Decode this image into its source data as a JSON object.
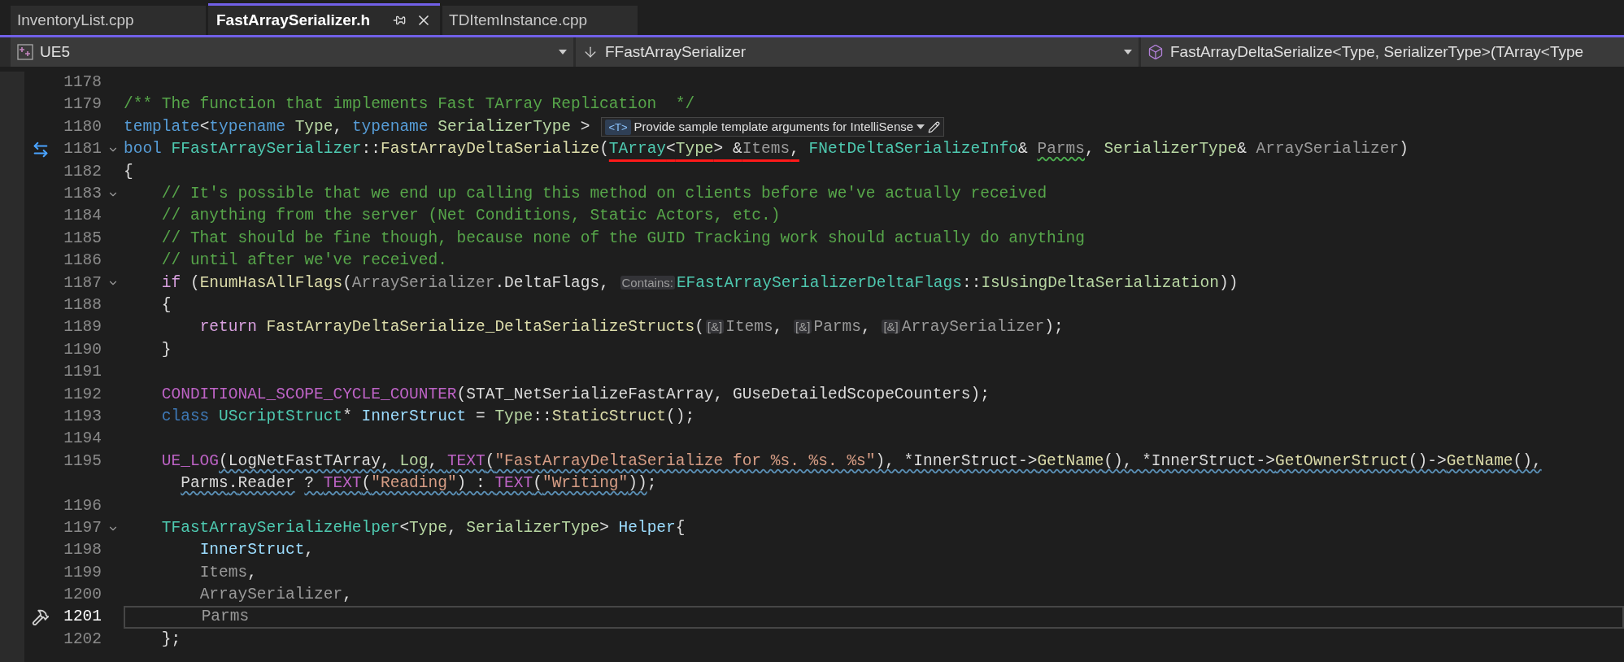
{
  "tabs": [
    {
      "label": "InventoryList.cpp",
      "selected": false
    },
    {
      "label": "FastArraySerializer.h",
      "selected": true
    },
    {
      "label": "TDItemInstance.cpp",
      "selected": false
    }
  ],
  "nav_bar": [
    {
      "kind": "project",
      "text": "UE5",
      "dropdown_arrow": true
    },
    {
      "kind": "scope",
      "text": "FFastArraySerializer",
      "dropdown_arrow": true
    },
    {
      "kind": "member",
      "text": "FastArrayDeltaSerialize<Type, SerializerType>(TArray<Type",
      "dropdown_arrow": false
    }
  ],
  "lines": [
    {
      "number": "1178",
      "fold": false,
      "current": false
    },
    {
      "number": "1179",
      "fold": false,
      "current": false,
      "tokens": [
        {
          "kind": "cm",
          "text": "/** The function that implements Fast TArray Replication  */"
        }
      ]
    },
    {
      "number": "1180",
      "fold": false,
      "current": false,
      "tokens": [
        {
          "kind": "kw",
          "text": "template"
        },
        {
          "kind": "p",
          "text": "<"
        },
        {
          "kind": "kw",
          "text": "typename "
        },
        {
          "kind": "tp",
          "text": "Type"
        },
        {
          "kind": "p",
          "text": ", "
        },
        {
          "kind": "kw",
          "text": "typename "
        },
        {
          "kind": "tp",
          "text": "SerializerType"
        },
        {
          "kind": "p",
          "text": " >"
        }
      ],
      "hint_bar": {
        "badge": "<T>",
        "text": "Provide sample template arguments for IntelliSense"
      }
    },
    {
      "number": "1181",
      "fold": true,
      "current": false,
      "swap_marker": true,
      "tokens": [
        {
          "kind": "kw",
          "text": "bool "
        },
        {
          "kind": "ty",
          "text": "FFastArraySerializer"
        },
        {
          "kind": "p",
          "text": "::"
        },
        {
          "kind": "fn",
          "text": "FastArrayDeltaSerialize"
        },
        {
          "kind": "p",
          "text": "("
        },
        {
          "kind": "ty",
          "text": "TArray",
          "marked": true
        },
        {
          "kind": "p",
          "text": "<",
          "marked": true
        },
        {
          "kind": "tp",
          "text": "Type",
          "marked": true
        },
        {
          "kind": "p",
          "text": "> &",
          "marked": true
        },
        {
          "kind": "prm",
          "text": "Items",
          "marked": true
        },
        {
          "kind": "p",
          "text": ",",
          "marked": true
        },
        {
          "kind": "ty",
          "text": " FNetDeltaSerializeInfo"
        },
        {
          "kind": "p",
          "text": "& "
        },
        {
          "kind": "prm",
          "text": "Parms",
          "warning_squiggle": true
        },
        {
          "kind": "p",
          "text": ", "
        },
        {
          "kind": "tp",
          "text": "SerializerType"
        },
        {
          "kind": "p",
          "text": "& "
        },
        {
          "kind": "prm",
          "text": "ArraySerializer"
        },
        {
          "kind": "p",
          "text": ")"
        }
      ]
    },
    {
      "number": "1182",
      "fold": false,
      "current": false,
      "tokens": [
        {
          "kind": "p",
          "text": "{"
        }
      ]
    },
    {
      "number": "1183",
      "fold": true,
      "current": false,
      "tokens": [
        {
          "kind": "cm",
          "text": "    // It's possible that we end up calling this method on clients before we've actually received"
        }
      ]
    },
    {
      "number": "1184",
      "fold": false,
      "current": false,
      "tokens": [
        {
          "kind": "cm",
          "text": "    // anything from the server (Net Conditions, Static Actors, etc.)"
        }
      ]
    },
    {
      "number": "1185",
      "fold": false,
      "current": false,
      "tokens": [
        {
          "kind": "cm",
          "text": "    // That should be fine though, because none of the GUID Tracking work should actually do anything"
        }
      ]
    },
    {
      "number": "1186",
      "fold": false,
      "current": false,
      "tokens": [
        {
          "kind": "cm",
          "text": "    // until after we've received."
        }
      ]
    },
    {
      "number": "1187",
      "fold": true,
      "current": false,
      "tokens": [
        {
          "kind": "ctl",
          "text": "    if"
        },
        {
          "kind": "p",
          "text": " ("
        },
        {
          "kind": "fn",
          "text": "EnumHasAllFlags"
        },
        {
          "kind": "p",
          "text": "("
        },
        {
          "kind": "prm",
          "text": "ArraySerializer"
        },
        {
          "kind": "p",
          "text": "."
        },
        {
          "kind": "fld",
          "text": "DeltaFlags"
        },
        {
          "kind": "p",
          "text": ", "
        },
        {
          "kind": "hint",
          "text": "Contains:"
        },
        {
          "kind": "ty",
          "text": "EFastArraySerializerDeltaFlags"
        },
        {
          "kind": "p",
          "text": "::"
        },
        {
          "kind": "en",
          "text": "IsUsingDeltaSerialization"
        },
        {
          "kind": "p",
          "text": "))"
        }
      ]
    },
    {
      "number": "1188",
      "fold": false,
      "current": false,
      "tokens": [
        {
          "kind": "p",
          "text": "    {"
        }
      ]
    },
    {
      "number": "1189",
      "fold": false,
      "current": false,
      "tokens": [
        {
          "kind": "ctl",
          "text": "        return"
        },
        {
          "kind": "fn",
          "text": " FastArrayDeltaSerialize_DeltaSerializeStructs"
        },
        {
          "kind": "p",
          "text": "("
        },
        {
          "kind": "hint",
          "text": "[&]"
        },
        {
          "kind": "prm",
          "text": "Items"
        },
        {
          "kind": "p",
          "text": ", "
        },
        {
          "kind": "hint",
          "text": "[&]"
        },
        {
          "kind": "prm",
          "text": "Parms"
        },
        {
          "kind": "p",
          "text": ", "
        },
        {
          "kind": "hint",
          "text": "[&]"
        },
        {
          "kind": "prm",
          "text": "ArraySerializer"
        },
        {
          "kind": "p",
          "text": ");"
        }
      ]
    },
    {
      "number": "1190",
      "fold": false,
      "current": false,
      "tokens": [
        {
          "kind": "p",
          "text": "    }"
        }
      ]
    },
    {
      "number": "1191",
      "fold": false,
      "current": false
    },
    {
      "number": "1192",
      "fold": false,
      "current": false,
      "tokens": [
        {
          "kind": "mac",
          "text": "    CONDITIONAL_SCOPE_CYCLE_COUNTER"
        },
        {
          "kind": "p",
          "text": "(STAT_NetSerializeFastArray, GUseDetailedScopeCounters);"
        }
      ]
    },
    {
      "number": "1193",
      "fold": false,
      "current": false,
      "tokens": [
        {
          "kind": "kw2",
          "text": "    class"
        },
        {
          "kind": "ty",
          "text": " UScriptStruct"
        },
        {
          "kind": "p",
          "text": "* "
        },
        {
          "kind": "loc",
          "text": "InnerStruct"
        },
        {
          "kind": "p",
          "text": " = "
        },
        {
          "kind": "tp",
          "text": "Type"
        },
        {
          "kind": "p",
          "text": "::"
        },
        {
          "kind": "fn",
          "text": "StaticStruct"
        },
        {
          "kind": "p",
          "text": "();"
        }
      ]
    },
    {
      "number": "1194",
      "fold": false,
      "current": false
    },
    {
      "number": "1195",
      "fold": false,
      "current": false,
      "tokens": [
        {
          "kind": "mac",
          "text": "    UE_LOG"
        },
        {
          "kind": "p",
          "text": "(LogNetFastTArray, ",
          "info_squiggle": true
        },
        {
          "kind": "en",
          "text": "Log",
          "info_squiggle": true
        },
        {
          "kind": "p",
          "text": ", ",
          "info_squiggle": true
        },
        {
          "kind": "mac",
          "text": "TEXT",
          "info_squiggle": true
        },
        {
          "kind": "p",
          "text": "(",
          "info_squiggle": true
        },
        {
          "kind": "str",
          "text": "\"FastArrayDeltaSerialize for %s. %s. %s\"",
          "info_squiggle": true
        },
        {
          "kind": "p",
          "text": "), *InnerStruct->",
          "info_squiggle": true
        },
        {
          "kind": "fn",
          "text": "GetName",
          "info_squiggle": true
        },
        {
          "kind": "p",
          "text": "(), *InnerStruct->",
          "info_squiggle": true
        },
        {
          "kind": "fn",
          "text": "GetOwnerStruct",
          "info_squiggle": true
        },
        {
          "kind": "p",
          "text": "()->",
          "info_squiggle": true
        },
        {
          "kind": "fn",
          "text": "GetName",
          "info_squiggle": true
        },
        {
          "kind": "p",
          "text": "(),",
          "info_squiggle": true
        }
      ]
    },
    {
      "fold": false,
      "current": false,
      "tokens": [
        {
          "kind": "fld",
          "text": "      Parms",
          "info_squiggle": true
        },
        {
          "kind": "p",
          "text": ".",
          "info_squiggle": true
        },
        {
          "kind": "fld",
          "text": "Reader",
          "info_squiggle": true
        },
        {
          "kind": "p",
          "text": " ? ",
          "info_squiggle": true
        },
        {
          "kind": "mac",
          "text": "TEXT",
          "info_squiggle": true
        },
        {
          "kind": "p",
          "text": "(",
          "info_squiggle": true
        },
        {
          "kind": "str",
          "text": "\"Reading\"",
          "info_squiggle": true
        },
        {
          "kind": "p",
          "text": ") : ",
          "info_squiggle": true
        },
        {
          "kind": "mac",
          "text": "TEXT",
          "info_squiggle": true
        },
        {
          "kind": "p",
          "text": "(",
          "info_squiggle": true
        },
        {
          "kind": "str",
          "text": "\"Writing\"",
          "info_squiggle": true
        },
        {
          "kind": "p",
          "text": "))",
          "info_squiggle": true
        },
        {
          "kind": "p",
          "text": ";"
        }
      ]
    },
    {
      "number": "1196",
      "fold": false,
      "current": false
    },
    {
      "number": "1197",
      "fold": true,
      "current": false,
      "tokens": [
        {
          "kind": "ty",
          "text": "    TFastArraySerializeHelper"
        },
        {
          "kind": "p",
          "text": "<"
        },
        {
          "kind": "tp",
          "text": "Type"
        },
        {
          "kind": "p",
          "text": ", "
        },
        {
          "kind": "tp",
          "text": "SerializerType"
        },
        {
          "kind": "p",
          "text": "> "
        },
        {
          "kind": "loc",
          "text": "Helper"
        },
        {
          "kind": "p",
          "text": "{"
        }
      ]
    },
    {
      "number": "1198",
      "fold": false,
      "current": false,
      "tokens": [
        {
          "kind": "loc",
          "text": "        InnerStruct"
        },
        {
          "kind": "p",
          "text": ","
        }
      ]
    },
    {
      "number": "1199",
      "fold": false,
      "current": false,
      "tokens": [
        {
          "kind": "prm",
          "text": "        Items"
        },
        {
          "kind": "p",
          "text": ","
        }
      ]
    },
    {
      "number": "1200",
      "fold": false,
      "current": false,
      "tokens": [
        {
          "kind": "prm",
          "text": "        ArraySerializer"
        },
        {
          "kind": "p",
          "text": ","
        }
      ]
    },
    {
      "number": "1201",
      "fold": false,
      "current": true,
      "hammer_marker": true,
      "tokens": [
        {
          "kind": "prm",
          "text": "        Parms"
        }
      ]
    },
    {
      "number": "1202",
      "fold": false,
      "current": false,
      "tokens": [
        {
          "kind": "p",
          "text": "    };"
        }
      ]
    }
  ]
}
